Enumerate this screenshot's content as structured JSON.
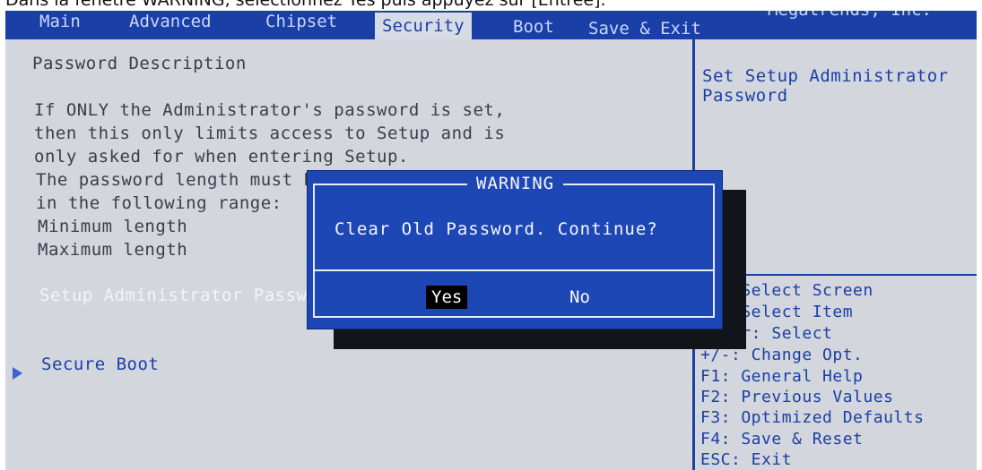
{
  "caption": "Dans la fenêtre WARNING, sélectionnez Yes puis appuyez sur [Entrée].",
  "menubar": {
    "tabs": [
      "Main",
      "Advanced",
      "Chipset",
      "Security",
      "Boot",
      "Save & Exit"
    ],
    "active_tab": "Security",
    "vendor": "Megatrends, Inc."
  },
  "left": {
    "heading": "Password Description",
    "desc_lines": [
      "If ONLY the Administrator's password is set,",
      "then this only limits access to Setup and is",
      "only asked for when entering Setup.",
      "The password length must be",
      "in the following range:",
      "Minimum length",
      "Maximum length"
    ],
    "setup_admin_label": "Setup Administrator Password",
    "secure_boot_label": "Secure Boot"
  },
  "right": {
    "help_text_1": "Set Setup Administrator",
    "help_text_2": "Password",
    "keys": [
      "→←: Select Screen",
      "↑↓: Select Item",
      "Enter: Select",
      "+/-: Change Opt.",
      "F1: General Help",
      "F2: Previous Values",
      "F3: Optimized Defaults",
      "F4: Save & Reset",
      "ESC: Exit"
    ]
  },
  "dialog": {
    "title": "WARNING",
    "message": "Clear Old Password. Continue?",
    "yes_label": "Yes",
    "no_label": "No",
    "selected": "Yes"
  },
  "colors": {
    "bios_blue": "#1a3fa6",
    "dialog_blue": "#1d47b5",
    "panel_grey": "#d3d6dc"
  }
}
